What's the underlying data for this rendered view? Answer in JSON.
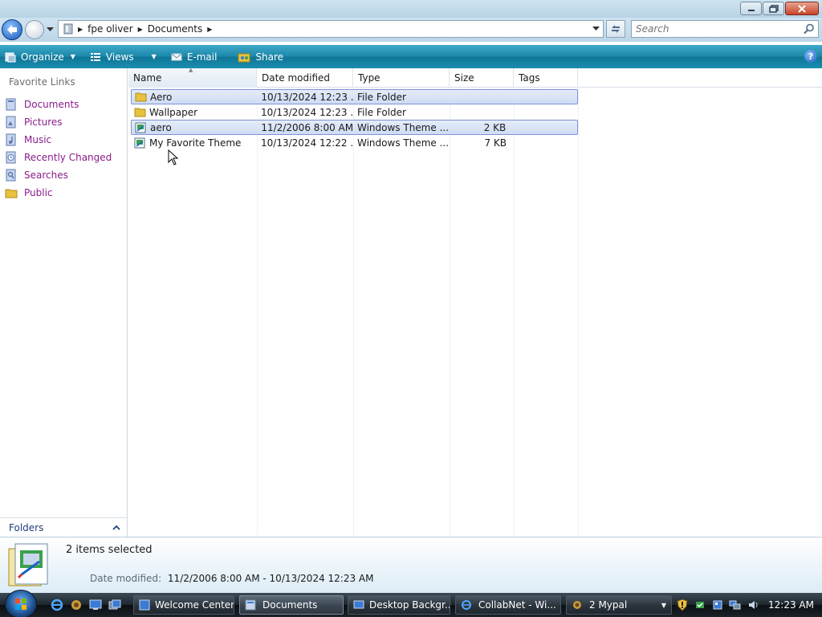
{
  "window": {
    "address": {
      "crumbs": [
        "fpe oliver",
        "Documents"
      ]
    },
    "search": {
      "placeholder": "Search"
    }
  },
  "commandbar": {
    "organize": "Organize",
    "views": "Views",
    "email": "E-mail",
    "share": "Share"
  },
  "navpane": {
    "title": "Favorite Links",
    "items": [
      {
        "label": "Documents",
        "icon": "documents-icon"
      },
      {
        "label": "Pictures",
        "icon": "pictures-icon"
      },
      {
        "label": "Music",
        "icon": "music-icon"
      },
      {
        "label": "Recently Changed",
        "icon": "recently-changed-icon"
      },
      {
        "label": "Searches",
        "icon": "searches-icon"
      },
      {
        "label": "Public",
        "icon": "public-folder-icon"
      }
    ],
    "folders_label": "Folders"
  },
  "filelist": {
    "columns": [
      "Name",
      "Date modified",
      "Type",
      "Size",
      "Tags"
    ],
    "rows": [
      {
        "name": "Aero",
        "date": "10/13/2024 12:23 ...",
        "type": "File Folder",
        "size": "",
        "icon": "folder-icon",
        "selected": true
      },
      {
        "name": "Wallpaper",
        "date": "10/13/2024 12:23 ...",
        "type": "File Folder",
        "size": "",
        "icon": "folder-icon",
        "selected": false
      },
      {
        "name": "aero",
        "date": "11/2/2006 8:00 AM",
        "type": "Windows Theme ...",
        "size": "2 KB",
        "icon": "theme-file-icon",
        "selected": true
      },
      {
        "name": "My Favorite Theme",
        "date": "10/13/2024 12:22 ...",
        "type": "Windows Theme ...",
        "size": "7 KB",
        "icon": "theme-file-icon",
        "selected": false
      }
    ]
  },
  "details": {
    "selection": "2 items selected",
    "date_label": "Date modified:",
    "date_value": "11/2/2006 8:00 AM - 10/13/2024 12:23 AM"
  },
  "taskbar": {
    "buttons": [
      {
        "label": "Welcome Center",
        "icon": "welcome-center-icon"
      },
      {
        "label": "Documents",
        "icon": "explorer-icon"
      },
      {
        "label": "Desktop Backgr...",
        "icon": "desktop-background-icon"
      },
      {
        "label": "CollabNet - Wi...",
        "icon": "internet-explorer-icon"
      },
      {
        "label": "2 Mypal",
        "icon": "mypal-icon"
      }
    ],
    "clock": "12:23 AM"
  }
}
